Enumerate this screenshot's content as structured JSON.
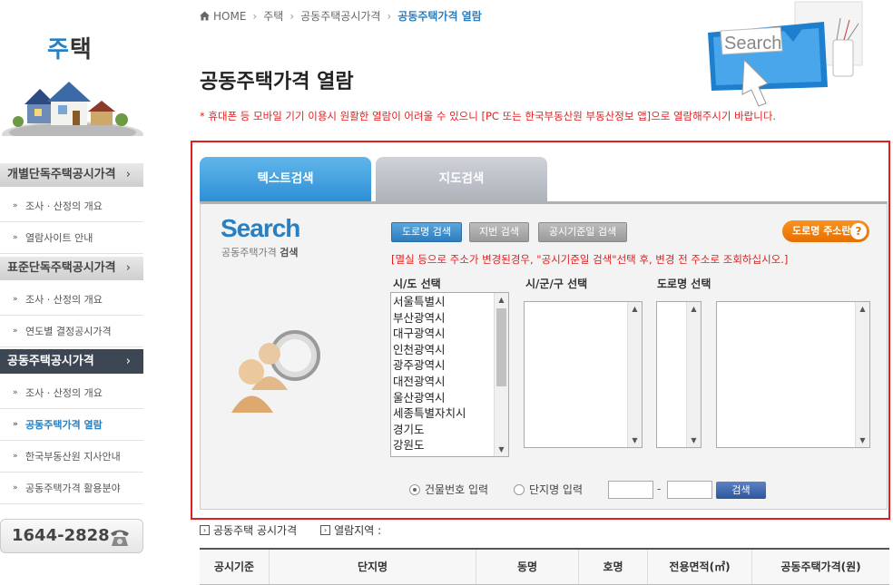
{
  "sidebar": {
    "title_accent": "주",
    "title_rest": "택",
    "sections": [
      {
        "label": "개별단독주택공시가격",
        "arrow": "›",
        "items": [
          "조사 · 산정의 개요",
          "열람사이트 안내"
        ]
      },
      {
        "label": "표준단독주택공시가격",
        "arrow": "›",
        "items": [
          "조사 · 산정의 개요",
          "연도별 결정공시가격"
        ]
      },
      {
        "label": "공동주택공시가격",
        "arrow": "›",
        "items": [
          "조사 · 산정의 개요",
          "공동주택가격 열람",
          "한국부동산원 지사안내",
          "공동주택가격 활용분야"
        ]
      }
    ],
    "phone": "1644-2828"
  },
  "breadcrumb": {
    "home": "HOME",
    "level1": "주택",
    "level2": "공동주택공시가격",
    "current": "공동주택가격 열람",
    "sep": "›"
  },
  "page_title": "공동주택가격 열람",
  "notice": "* 휴대폰 등 모바일 기기 이용시 원활한 열람이 어려울 수 있으니 [PC 또는 한국부동산원 부동산정보 앱]으로 열람해주시기 바랍니다.",
  "tabs": {
    "text_search": "텍스트검색",
    "map_search": "지도검색"
  },
  "search_panel": {
    "logo": "Search",
    "sub_plain": "공동주택가격 ",
    "sub_bold": "검색",
    "deco_search_text": "Search",
    "btn_road": "도로명 검색",
    "btn_lot": "지번 검색",
    "btn_date": "공시기준일 검색",
    "btn_road_addr": "도로명 주소란",
    "btn_road_addr_q": "?",
    "hint": "[멸실 등으로 주소가 변경된경우, \"공시기준일 검색\"선택 후, 변경 전 주소로 조회하십시오.]",
    "label_sido": "시/도 선택",
    "label_sigungu": "시/군/구 선택",
    "label_road": "도로명 선택",
    "sido_options": [
      "서울특별시",
      "부산광역시",
      "대구광역시",
      "인천광역시",
      "광주광역시",
      "대전광역시",
      "울산광역시",
      "세종특별자치시",
      "경기도",
      "강원도"
    ],
    "radio_building": "건물번호 입력",
    "radio_complex": "단지명 입력",
    "dash": "-",
    "btn_search": "검색"
  },
  "table": {
    "link1": "공동주택 공시가격",
    "link2": "열람지역 :",
    "headers": [
      "공시기준",
      "단지명",
      "동명",
      "호명",
      "전용면적(㎡)",
      "공동주택가격(원)"
    ]
  },
  "colors": {
    "accent_blue": "#2a7fc1",
    "notice_red": "#e02020",
    "orange": "#e66f00",
    "active_menu": "#3d4653"
  }
}
